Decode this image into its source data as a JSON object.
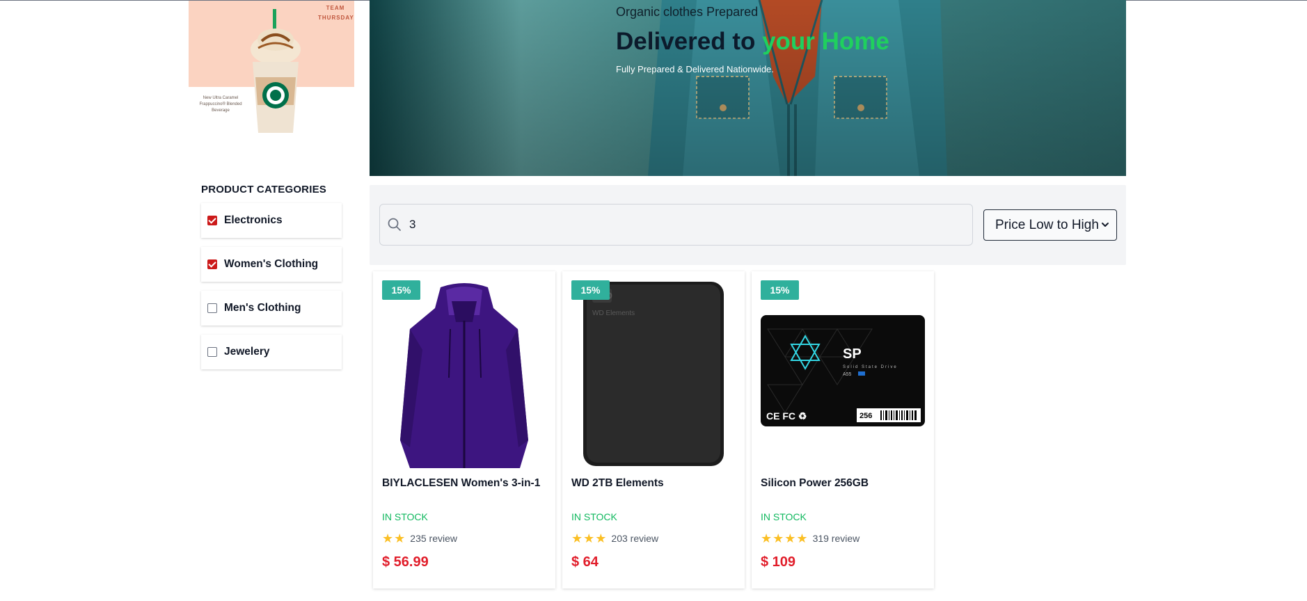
{
  "promo": {
    "team_line1": "TEAM",
    "team_line2": "THURSDAY",
    "caption": "New Ultra Caramel Frappuccino® Blended Beverage"
  },
  "hero": {
    "subtitle": "Organic clothes Prepared",
    "title_main": "Delivered to ",
    "title_accent": "your Home",
    "note": "Fully Prepared & Delivered Nationwide."
  },
  "sidebar": {
    "title": "PRODUCT CATEGORIES",
    "categories": [
      {
        "label": "Electronics",
        "checked": true
      },
      {
        "label": "Women's Clothing",
        "checked": true
      },
      {
        "label": "Men's Clothing",
        "checked": false
      },
      {
        "label": "Jewelery",
        "checked": false
      }
    ]
  },
  "toolbar": {
    "search_icon": "search-icon",
    "search_value": "3",
    "sort_selected": "Price Low to High"
  },
  "products": [
    {
      "discount": "15%",
      "name": "BIYLACLESEN Women's 3-in-1",
      "stock": "IN STOCK",
      "stars": 2,
      "reviews": "235 review",
      "price": "$ 56.99",
      "image": "purple-jacket"
    },
    {
      "discount": "15%",
      "name": "WD 2TB Elements",
      "stock": "IN STOCK",
      "stars": 3,
      "reviews": "203 review",
      "price": "$ 64",
      "image": "black-hard-drive",
      "image_text": "WD Elements"
    },
    {
      "discount": "15%",
      "name": "Silicon Power 256GB",
      "stock": "IN STOCK",
      "stars": 4,
      "reviews": "319 review",
      "price": "$ 109",
      "image": "ssd-drive",
      "image_text": {
        "brand": "SP",
        "line": "Solid State Drive",
        "model": "A55",
        "capacity": "256"
      }
    }
  ],
  "colors": {
    "accent_green": "#1fd05e",
    "badge": "#30b09c",
    "price_red": "#e11d2a",
    "checkbox_red": "#cc1a1a",
    "star": "#fbbf24"
  }
}
